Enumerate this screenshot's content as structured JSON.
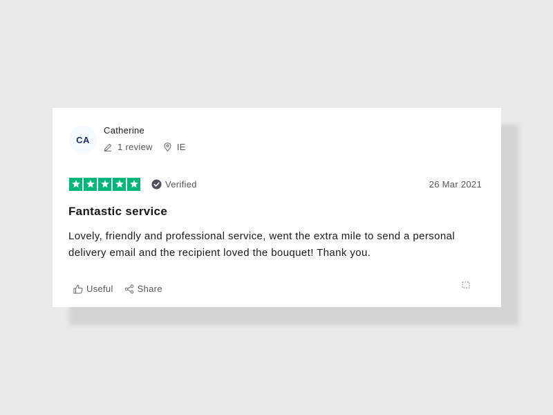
{
  "reviewer": {
    "initials": "CA",
    "name": "Catherine",
    "review_count": "1 review",
    "country": "IE"
  },
  "rating": {
    "stars": 5,
    "max_stars": 5,
    "star_color": "#00b67a",
    "verified_label": "Verified",
    "date": "26 Mar 2021"
  },
  "review": {
    "title": "Fantastic service",
    "body": "Lovely, friendly and professional service, went the extra mile to send a personal delivery email and the recipient loved the bouquet! Thank you."
  },
  "actions": {
    "useful_label": "Useful",
    "share_label": "Share",
    "useful_icon": "thumbs-up-icon",
    "share_icon": "share-icon",
    "more_icon": "more-options-icon"
  }
}
